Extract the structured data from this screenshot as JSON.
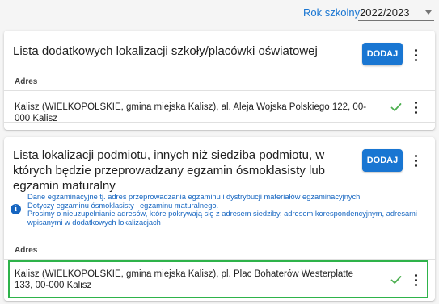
{
  "toolbar": {
    "year_label": "Rok szkolny:",
    "year_value": "2022/2023"
  },
  "card_additional": {
    "title": "Lista dodatkowych lokalizacji szkoły/placówki oświatowej",
    "add_label": "DODAJ",
    "column_header": "Adres",
    "rows": [
      {
        "address": "Kalisz (WIELKOPOLSKIE, gmina miejska Kalisz), al. Aleja Wojska Polskiego 122, 00-000 Kalisz"
      }
    ]
  },
  "card_exam": {
    "title": "Lista lokalizacji podmiotu, innych niż siedziba podmiotu, w których będzie przeprowadzany egzamin ósmoklasisty lub egzamin maturalny",
    "add_label": "DODAJ",
    "info": {
      "line1": "Dane egzaminacyjne tj. adres przeprowadzania egzaminu i dystrybucji materiałów egzaminacyjnych",
      "line2": "Dotyczy egzaminu ósmoklasisty i egzaminu maturalnego.",
      "line3": "Prosimy o nieuzupełnianie adresów, które pokrywają się z adresem siedziby, adresem korespondencyjnym, adresami",
      "line4": "wpisanymi w dodatkowych lokalizacjach"
    },
    "column_header": "Adres",
    "rows": [
      {
        "address": "Kalisz (WIELKOPOLSKIE, gmina miejska Kalisz), pl. Plac Bohaterów Westerplatte 133, 00-000 Kalisz"
      }
    ]
  },
  "colors": {
    "accent": "#1976d2",
    "info_text": "#1565c0",
    "check": "#4caf50",
    "highlight_border": "#2eb34a"
  },
  "icons": {
    "dropdown": "chevron-down-icon",
    "menu": "more-vert-icon",
    "status": "check-icon",
    "info": "info-icon"
  }
}
